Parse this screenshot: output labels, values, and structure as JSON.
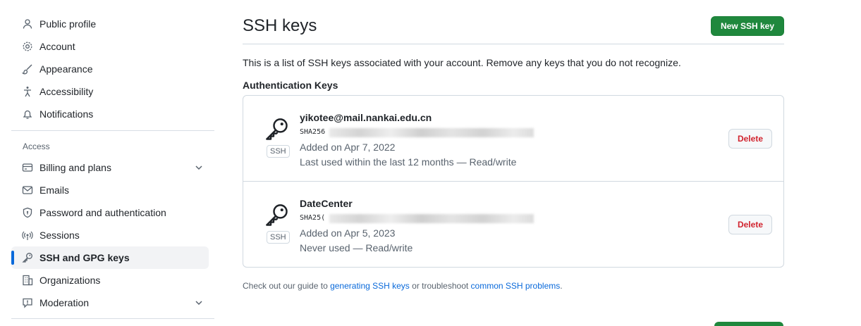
{
  "sidebar": {
    "top_items": [
      {
        "label": "Public profile",
        "icon": "person-icon"
      },
      {
        "label": "Account",
        "icon": "gear-icon"
      },
      {
        "label": "Appearance",
        "icon": "paintbrush-icon"
      },
      {
        "label": "Accessibility",
        "icon": "accessibility-icon"
      },
      {
        "label": "Notifications",
        "icon": "bell-icon"
      }
    ],
    "access_title": "Access",
    "access_items": [
      {
        "label": "Billing and plans",
        "icon": "credit-card-icon",
        "expandable": true
      },
      {
        "label": "Emails",
        "icon": "mail-icon"
      },
      {
        "label": "Password and authentication",
        "icon": "shield-lock-icon"
      },
      {
        "label": "Sessions",
        "icon": "broadcast-icon"
      },
      {
        "label": "SSH and GPG keys",
        "icon": "key-icon",
        "active": true
      },
      {
        "label": "Organizations",
        "icon": "organization-icon"
      },
      {
        "label": "Moderation",
        "icon": "report-icon",
        "expandable": true
      }
    ]
  },
  "main": {
    "title": "SSH keys",
    "new_button": "New SSH key",
    "intro": "This is a list of SSH keys associated with your account. Remove any keys that you do not recognize.",
    "section_title": "Authentication Keys",
    "keys": [
      {
        "title": "yikotee@mail.nankai.edu.cn",
        "fingerprint_prefix": "SHA256",
        "badge": "SSH",
        "added": "Added on Apr 7, 2022",
        "last_used": "Last used within the last 12 months — Read/write",
        "delete_label": "Delete"
      },
      {
        "title": "DateCenter",
        "fingerprint_prefix": "SHA25(",
        "badge": "SSH",
        "added": "Added on Apr 5, 2023",
        "last_used": "Never used — Read/write",
        "delete_label": "Delete"
      }
    ],
    "footer": {
      "prefix": "Check out our guide to ",
      "link1": "generating SSH keys",
      "middle": " or troubleshoot ",
      "link2": "common SSH problems",
      "suffix": "."
    }
  },
  "colors": {
    "accent_blue": "#0969da",
    "primary_green": "#1f883d",
    "danger_red": "#d1242f"
  }
}
